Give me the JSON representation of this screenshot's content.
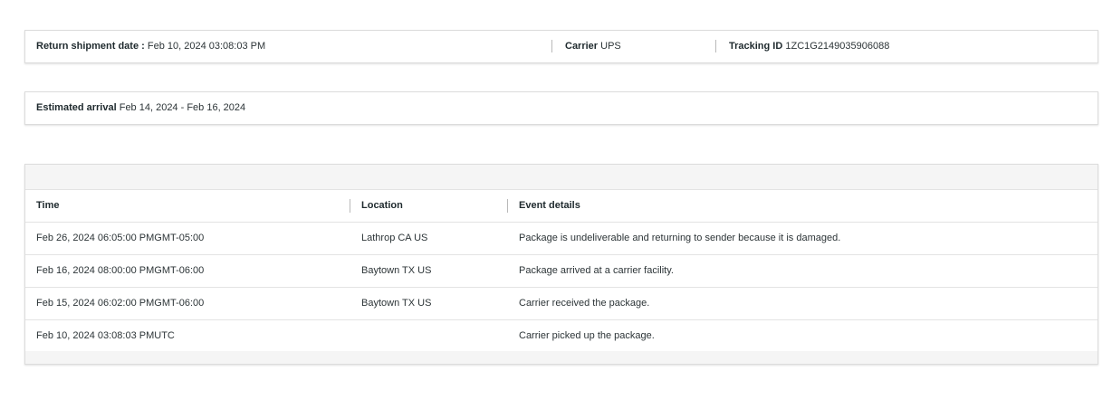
{
  "shipment": {
    "return_date_label": "Return shipment date :",
    "return_date_value": "Feb 10, 2024 03:08:03 PM",
    "carrier_label": "Carrier",
    "carrier_value": "UPS",
    "tracking_label": "Tracking ID",
    "tracking_value": "1ZC1G2149035906088"
  },
  "arrival": {
    "label": "Estimated arrival",
    "value": "Feb 14, 2024 - Feb 16, 2024"
  },
  "events": {
    "columns": [
      "Time",
      "Location",
      "Event details"
    ],
    "rows": [
      {
        "time": "Feb 26, 2024 06:05:00 PMGMT-05:00",
        "location": "Lathrop CA US",
        "details": "Package is undeliverable and returning to sender because it is damaged."
      },
      {
        "time": "Feb 16, 2024 08:00:00 PMGMT-06:00",
        "location": "Baytown TX US",
        "details": "Package arrived at a carrier facility."
      },
      {
        "time": "Feb 15, 2024 06:02:00 PMGMT-06:00",
        "location": "Baytown TX US",
        "details": "Carrier received the package."
      },
      {
        "time": "Feb 10, 2024 03:08:03 PMUTC",
        "location": "",
        "details": "Carrier picked up the package."
      }
    ]
  }
}
